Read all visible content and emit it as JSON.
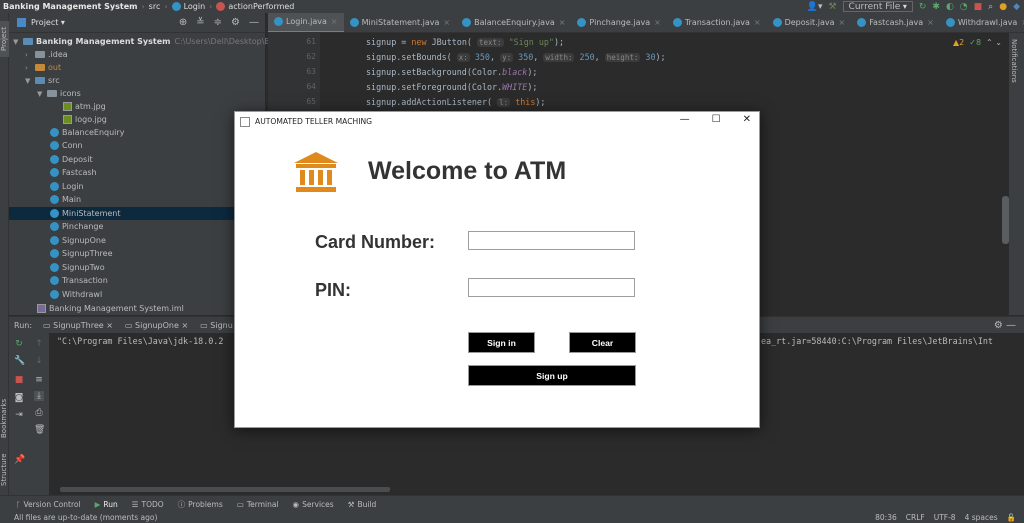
{
  "navbar": {
    "project": "Banking Management System",
    "crumbs": [
      "src",
      "Login",
      "actionPerformed"
    ],
    "run_config": "Current File"
  },
  "stripe": {
    "project": "Project",
    "bookmarks": "Bookmarks",
    "structure": "Structure",
    "notifications": "Notifications"
  },
  "project": {
    "header": "Project",
    "root": "Banking Management System",
    "root_path": "C:\\Users\\Dell\\Desktop\\Banking",
    "items": [
      ".idea",
      "out",
      "src",
      "icons",
      "atm.jpg",
      "logo.jpg",
      "BalanceEnquiry",
      "Conn",
      "Deposit",
      "Fastcash",
      "Login",
      "Main",
      "MiniStatement",
      "Pinchange",
      "SignupOne",
      "SignupThree",
      "SignupTwo",
      "Transaction",
      "Withdrawl"
    ],
    "iml": "Banking Management System.iml"
  },
  "tabs": [
    "Login.java",
    "MiniStatement.java",
    "BalanceEnquiry.java",
    "Pinchange.java",
    "Transaction.java",
    "Deposit.java",
    "Fastcash.java",
    "Withdrawl.java"
  ],
  "editor": {
    "line_numbers": [
      "61",
      "62",
      "63",
      "64",
      "65"
    ],
    "warnings": "2",
    "checks": "8"
  },
  "run": {
    "label": "Run:",
    "tabs": [
      "SignupThree",
      "SignupOne",
      "Signu"
    ],
    "console_left": "\"C:\\Program Files\\Java\\jdk-18.0.2",
    "console_right": "ea_rt.jar=58440:C:\\Program Files\\JetBrains\\Int"
  },
  "bottombar": [
    "Version Control",
    "Run",
    "TODO",
    "Problems",
    "Terminal",
    "Services",
    "Build"
  ],
  "status": {
    "message": "All files are up-to-date (moments ago)",
    "position": "80:36",
    "line_sep": "CRLF",
    "encoding": "UTF-8",
    "indent": "4 spaces"
  },
  "dialog": {
    "title": "AUTOMATED TELLER MACHING",
    "heading": "Welcome to ATM",
    "card_label": "Card Number:",
    "pin_label": "PIN:",
    "card_value": "",
    "pin_value": "",
    "signin": "Sign in",
    "clear": "Clear",
    "signup": "Sign up",
    "icon_color": "#e08a1e"
  }
}
